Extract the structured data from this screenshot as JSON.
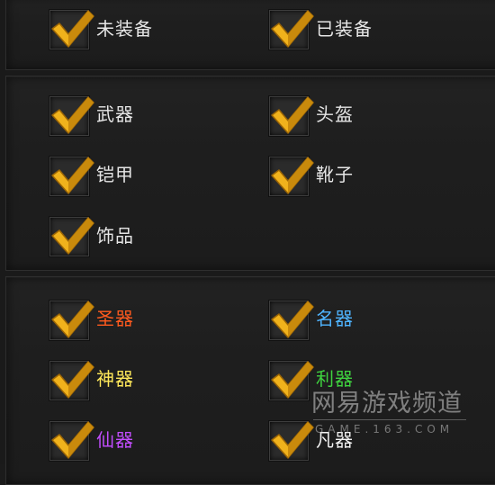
{
  "accent": {
    "check": "#f0b21c",
    "check_dark": "#b77a07"
  },
  "sections": [
    {
      "items": [
        {
          "label": "未装备",
          "checked": true,
          "color": "#e6e6e6"
        },
        {
          "label": "已装备",
          "checked": true,
          "color": "#e6e6e6"
        }
      ]
    },
    {
      "items": [
        {
          "label": "武器",
          "checked": true,
          "color": "#e6e6e6"
        },
        {
          "label": "头盔",
          "checked": true,
          "color": "#e6e6e6"
        },
        {
          "label": "铠甲",
          "checked": true,
          "color": "#e6e6e6"
        },
        {
          "label": "靴子",
          "checked": true,
          "color": "#e6e6e6"
        },
        {
          "label": "饰品",
          "checked": true,
          "color": "#e6e6e6"
        }
      ]
    },
    {
      "items": [
        {
          "label": "圣器",
          "checked": true,
          "color": "#ff5a1e"
        },
        {
          "label": "名器",
          "checked": true,
          "color": "#4fb4ff"
        },
        {
          "label": "神器",
          "checked": true,
          "color": "#ffe85a"
        },
        {
          "label": "利器",
          "checked": true,
          "color": "#3fd23f"
        },
        {
          "label": "仙器",
          "checked": true,
          "color": "#c24dff"
        },
        {
          "label": "凡器",
          "checked": true,
          "color": "#f2f2f2"
        }
      ]
    }
  ],
  "watermark": {
    "cn": "网易游戏频道",
    "en": "GAME.163.COM"
  }
}
